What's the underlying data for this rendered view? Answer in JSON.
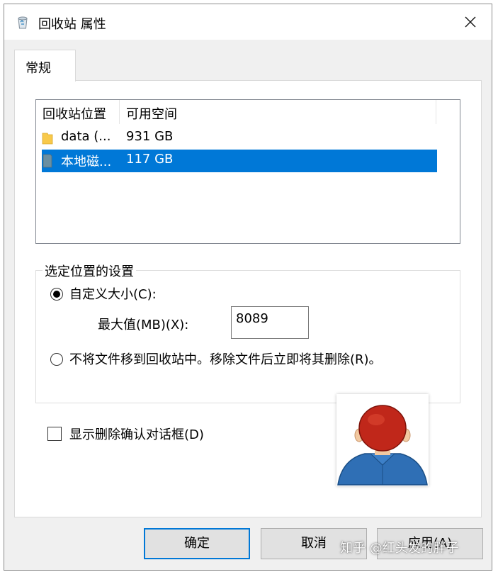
{
  "window": {
    "title": "回收站 属性",
    "close_icon": "close-icon"
  },
  "tabs": [
    {
      "label": "常规"
    }
  ],
  "listview": {
    "columns": [
      "回收站位置",
      "可用空间"
    ],
    "rows": [
      {
        "name": "data (...",
        "space": "931 GB",
        "icon": "folder-icon",
        "selected": false
      },
      {
        "name": "本地磁...",
        "space": "117 GB",
        "icon": "drive-icon",
        "selected": true
      }
    ]
  },
  "settings": {
    "group_title": "选定位置的设置",
    "custom_size_label": "自定义大小(C):",
    "max_value_label": "最大值(MB)(X):",
    "max_value": "8089",
    "no_recycle_label": "不将文件移到回收站中。移除文件后立即将其删除(R)。",
    "selected_option": "custom_size"
  },
  "confirm_delete_label": "显示删除确认对话框(D)",
  "confirm_delete_checked": false,
  "buttons": {
    "ok": "确定",
    "cancel": "取消",
    "apply": "应用(A)"
  },
  "watermark": "知乎 @红头发的胖子",
  "colors": {
    "selection": "#0078d7",
    "folder": "#f8c94a",
    "drive": "#6a8fa1"
  }
}
